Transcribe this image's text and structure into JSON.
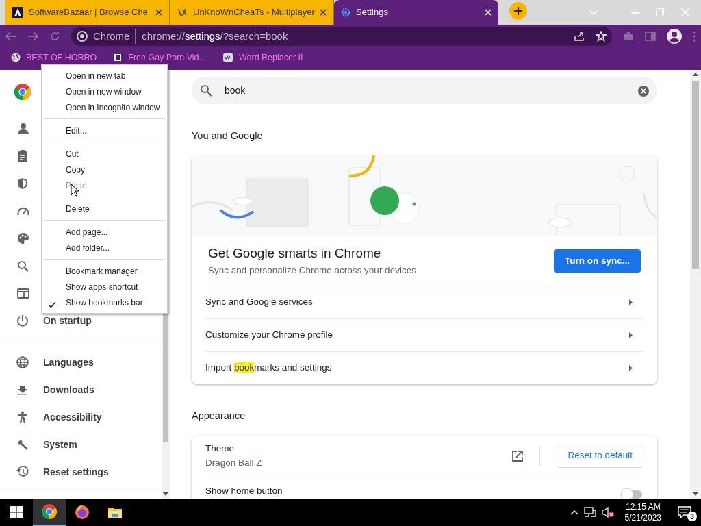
{
  "tabs": [
    {
      "title": "SoftwareBazaar | Browse Che",
      "selected": false
    },
    {
      "title": "UnKnoWnCheaTs - Multiplayer",
      "selected": false
    },
    {
      "title": "Settings",
      "selected": true
    }
  ],
  "omnibox": {
    "chip": "Chrome",
    "url": "chrome://**settings**/?search=book"
  },
  "bookmarks": [
    "BEST OF HORRO",
    "Free Gay Porn Vid...",
    "Word Replacer II"
  ],
  "context_menu": {
    "groups": [
      [
        {
          "label": "Open in new tab",
          "disabled": false,
          "checked": false
        },
        {
          "label": "Open in new window",
          "disabled": false,
          "checked": false
        },
        {
          "label": "Open in Incognito window",
          "disabled": false,
          "checked": false
        }
      ],
      [
        {
          "label": "Edit...",
          "disabled": false,
          "checked": false
        }
      ],
      [
        {
          "label": "Cut",
          "disabled": false,
          "checked": false
        },
        {
          "label": "Copy",
          "disabled": false,
          "checked": false
        },
        {
          "label": "Paste",
          "disabled": true,
          "checked": false
        }
      ],
      [
        {
          "label": "Delete",
          "disabled": false,
          "checked": false
        }
      ],
      [
        {
          "label": "Add page...",
          "disabled": false,
          "checked": false
        },
        {
          "label": "Add folder...",
          "disabled": false,
          "checked": false
        }
      ],
      [
        {
          "label": "Bookmark manager",
          "disabled": false,
          "checked": false
        },
        {
          "label": "Show apps shortcut",
          "disabled": false,
          "checked": false
        },
        {
          "label": "Show bookmarks bar",
          "disabled": false,
          "checked": true
        }
      ]
    ]
  },
  "sidebar": {
    "groups": [
      [
        {
          "label": "On startup"
        }
      ],
      [
        {
          "label": "Languages"
        },
        {
          "label": "Downloads"
        },
        {
          "label": "Accessibility"
        },
        {
          "label": "System"
        },
        {
          "label": "Reset settings"
        }
      ]
    ]
  },
  "search": {
    "value": "book"
  },
  "sections": [
    {
      "title": "You and Google",
      "promo": {
        "title": "Get Google smarts in Chrome",
        "subtitle": "Sync and personalize Chrome across your devices",
        "button": "Turn on sync..."
      },
      "rows": [
        {
          "kind": "link",
          "parts": [
            {
              "text": "Sync and Google services",
              "highlight": false
            }
          ]
        },
        {
          "kind": "link",
          "parts": [
            {
              "text": "Customize your Chrome profile",
              "highlight": false
            }
          ]
        },
        {
          "kind": "link",
          "parts": [
            {
              "text": "Import ",
              "highlight": false
            },
            {
              "text": "book",
              "highlight": true
            },
            {
              "text": "marks and settings",
              "highlight": false
            }
          ]
        }
      ]
    },
    {
      "title": "Appearance",
      "rows": [
        {
          "kind": "theme",
          "parts": [
            {
              "text": "Theme",
              "highlight": false
            }
          ],
          "value": "Dragon Ball Z",
          "button": "Reset to default"
        },
        {
          "kind": "toggle",
          "parts": [
            {
              "text": "Show home button",
              "highlight": false
            }
          ],
          "on": false
        }
      ]
    }
  ],
  "taskbar": {
    "apps": [
      {
        "kind": "chrome",
        "selected": true
      },
      {
        "kind": "firefox",
        "selected": false
      },
      {
        "kind": "files",
        "selected": false
      }
    ],
    "time": "12:15 AM",
    "date": "5/21/2023",
    "notifications": "3"
  }
}
